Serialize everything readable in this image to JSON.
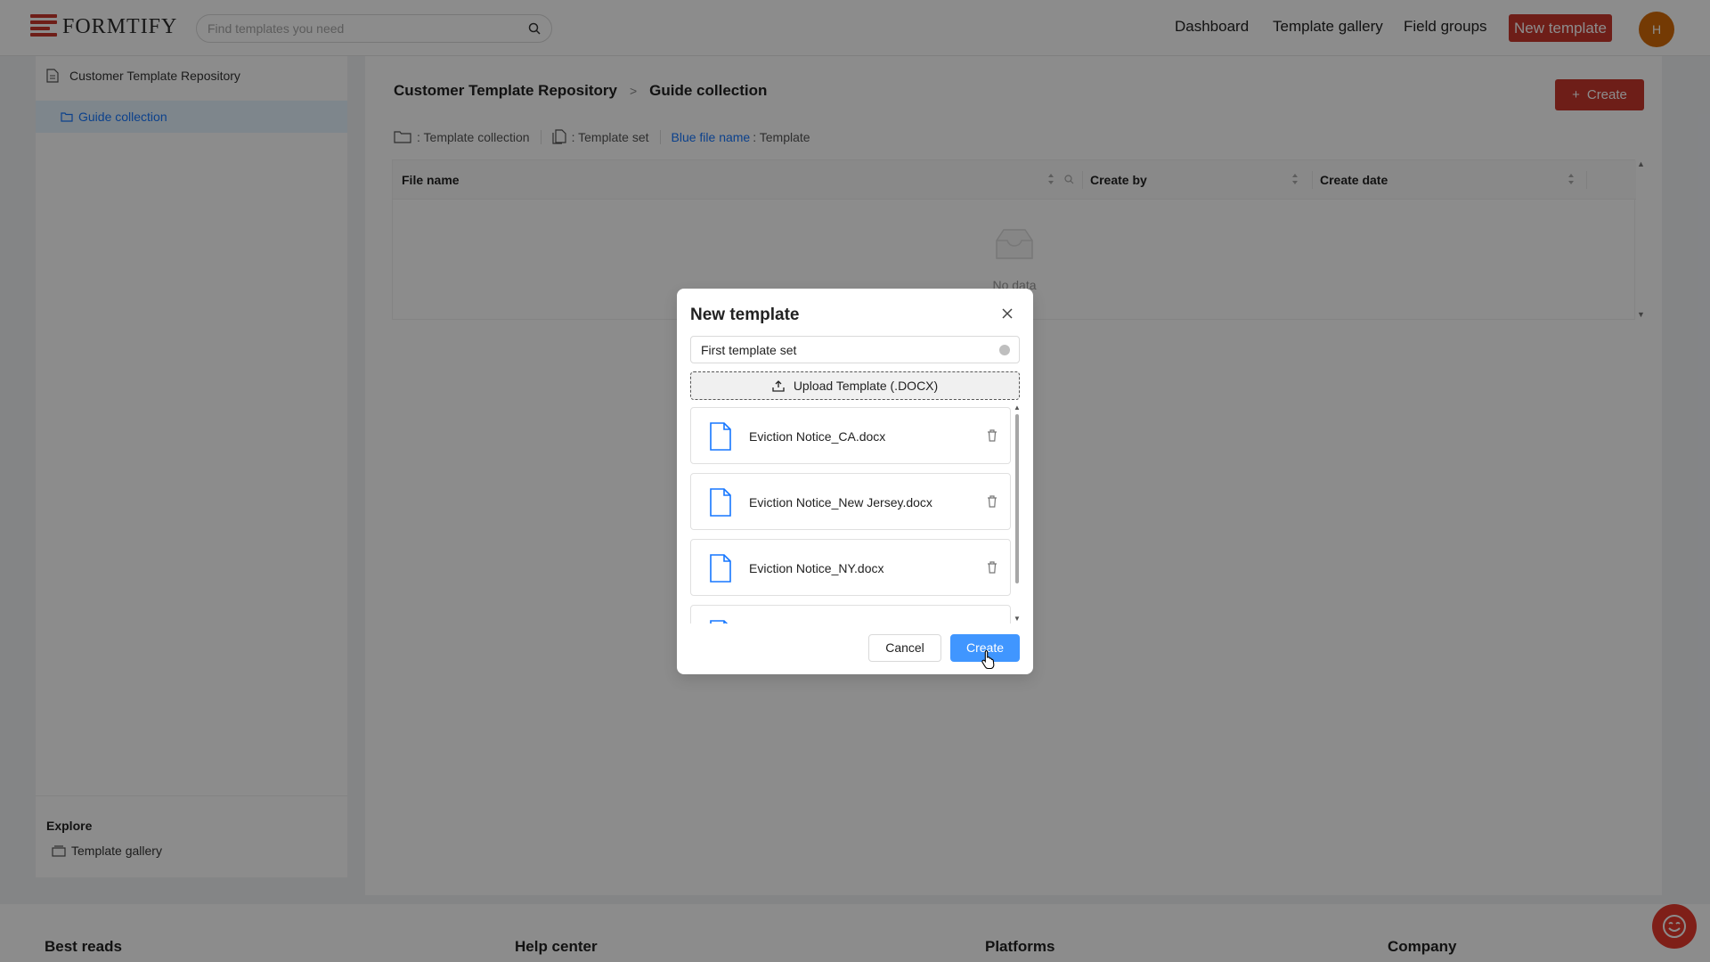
{
  "header": {
    "logo_text": "FORMTIFY",
    "search_placeholder": "Find templates you need",
    "nav": [
      "Dashboard",
      "Template gallery",
      "Field groups"
    ],
    "new_template": "New template",
    "avatar_initial": "H"
  },
  "sidebar": {
    "repository": "Customer Template Repository",
    "collection": "Guide collection",
    "explore_heading": "Explore",
    "gallery": "Template gallery"
  },
  "main": {
    "breadcrumb": [
      "Customer Template Repository",
      "Guide collection"
    ],
    "create_label": "Create",
    "legend": {
      "collection": ": Template collection",
      "set": ": Template set",
      "blue": "Blue file name",
      "template": ": Template"
    },
    "table": {
      "columns": [
        "File name",
        "Create by",
        "Create date"
      ],
      "empty_text": "No data"
    }
  },
  "footer": {
    "columns": [
      "Best reads",
      "Help center",
      "Platforms",
      "Company"
    ]
  },
  "modal": {
    "title": "New template",
    "input_value": "First template set",
    "upload_label": "Upload Template (.DOCX)",
    "files": [
      "Eviction Notice_CA.docx",
      "Eviction Notice_New Jersey.docx",
      "Eviction Notice_NY.docx",
      ""
    ],
    "cancel_label": "Cancel",
    "create_label": "Create"
  },
  "colors": {
    "brand_red": "#c8372d",
    "primary_blue": "#4096ff",
    "link_blue": "#1677ff",
    "avatar": "#d46b08"
  }
}
